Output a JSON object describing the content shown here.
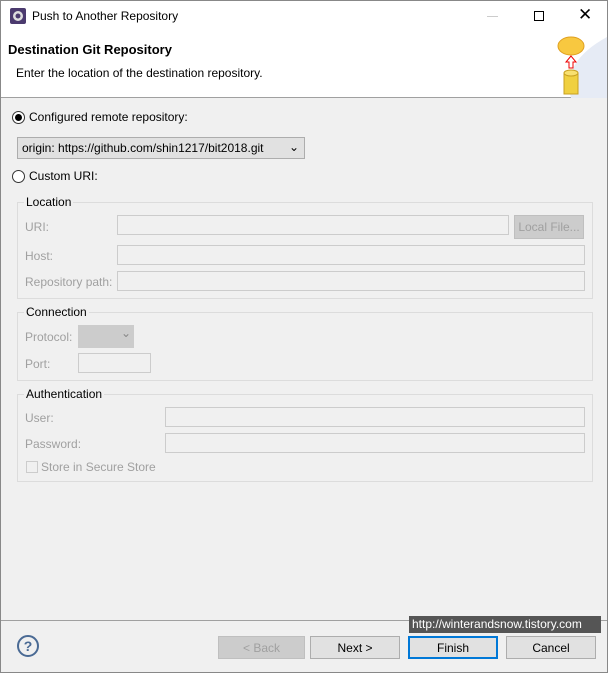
{
  "window": {
    "title": "Push to Another Repository"
  },
  "header": {
    "title": "Destination Git Repository",
    "description": "Enter the location of the destination repository."
  },
  "configured": {
    "label": "Configured remote repository:",
    "selected": "origin: https://github.com/shin1217/bit2018.git"
  },
  "custom": {
    "label": "Custom URI:"
  },
  "location": {
    "title": "Location",
    "uri_label": "URI:",
    "local_file": "Local File...",
    "host_label": "Host:",
    "repo_path_label": "Repository path:"
  },
  "connection": {
    "title": "Connection",
    "protocol_label": "Protocol:",
    "port_label": "Port:"
  },
  "auth": {
    "title": "Authentication",
    "user_label": "User:",
    "password_label": "Password:",
    "store_label": "Store in Secure Store"
  },
  "footer": {
    "back": "< Back",
    "next": "Next >",
    "finish": "Finish",
    "cancel": "Cancel",
    "tooltip": "http://winterandsnow.tistory.com"
  }
}
